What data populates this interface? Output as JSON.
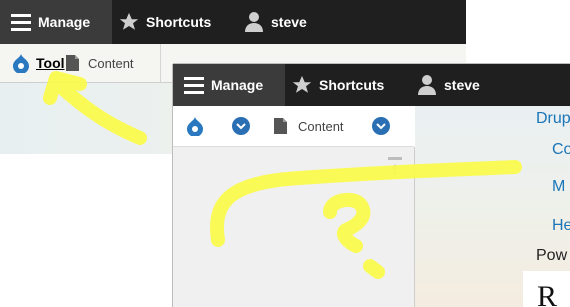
{
  "back_window": {
    "toolbar": {
      "manage_label": "Manage",
      "shortcuts_label": "Shortcuts",
      "user_label": "steve"
    },
    "tray": {
      "tools_label": "Tool",
      "content_label": "Content"
    }
  },
  "front_window": {
    "toolbar": {
      "manage_label": "Manage",
      "shortcuts_label": "Shortcuts",
      "user_label": "steve"
    },
    "tray": {
      "content_label": "Content"
    },
    "main": {
      "links": [
        "Drup",
        "Co",
        "M",
        "He"
      ],
      "powered_label": "Pow",
      "heading_fragment": "R"
    }
  },
  "colors": {
    "toolbar_bg": "#1f1f1f",
    "link": "#1b76b8",
    "annotation": "#fbfb4a",
    "drupal_blue": "#2a6fb3"
  }
}
